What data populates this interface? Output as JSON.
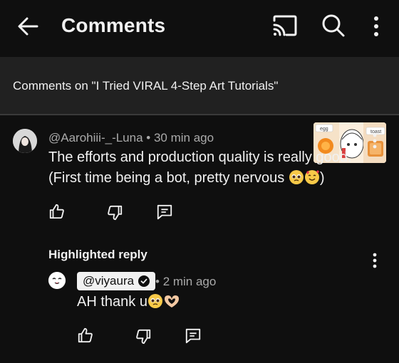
{
  "header": {
    "title": "Comments",
    "icons": [
      "back-arrow-icon",
      "cast-icon",
      "search-icon",
      "more-vert-icon"
    ]
  },
  "video": {
    "comments_on": "Comments on \"I Tried VIRAL 4-Step Art Tutorials\"",
    "thumbnail_labels": [
      "egg",
      "toast"
    ]
  },
  "comment": {
    "author": "@Aarohiii-_-Luna",
    "time": "30 min ago",
    "text_line1": "The efforts and production quality is really good.",
    "text_line2": "(First time being a bot, pretty nervous",
    "text_line2_end": ")",
    "emojis": [
      "pleading-face",
      "smiling-face-with-hearts"
    ]
  },
  "highlighted": {
    "label": "Highlighted reply",
    "author": "@viyaura",
    "verified": true,
    "time": "2 min ago",
    "text": "AH thank u",
    "emojis": [
      "pleading-face",
      "heart-hands"
    ]
  },
  "colors": {
    "background": "#0f0f0f",
    "video_bar": "#212121",
    "text": "#f1f1f1",
    "meta": "#aaaaaa"
  }
}
